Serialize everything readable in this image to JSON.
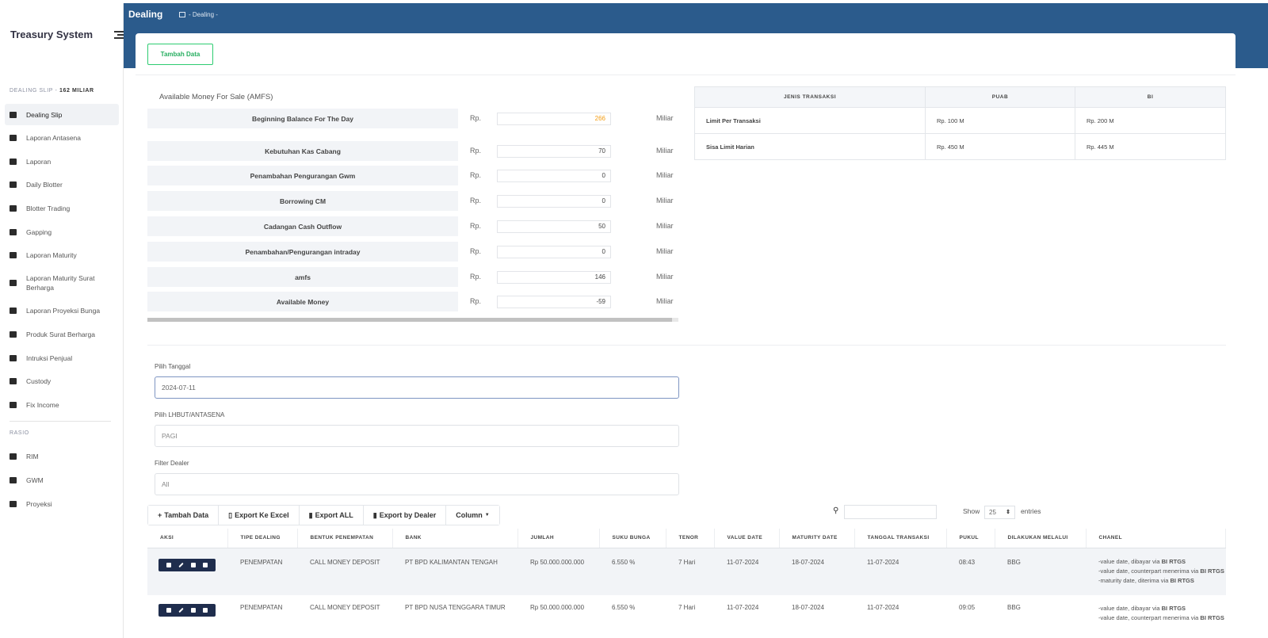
{
  "sidebar": {
    "brand": "Treasury System",
    "section1_title": "DEALING SLIP - ",
    "section1_bold": "162 MILIAR",
    "items": [
      {
        "label": "Dealing Slip",
        "icon": "calendar-icon"
      },
      {
        "label": "Laporan Antasena",
        "icon": "calendar-icon"
      },
      {
        "label": "Laporan",
        "icon": "list-icon"
      },
      {
        "label": "Daily Blotter",
        "icon": "folder-icon"
      },
      {
        "label": "Blotter Trading",
        "icon": "book-icon"
      },
      {
        "label": "Gapping",
        "icon": "building-icon"
      },
      {
        "label": "Laporan Maturity",
        "icon": "calendar-icon"
      },
      {
        "label": "Laporan Maturity Surat Berharga",
        "icon": "calendar-icon"
      },
      {
        "label": "Laporan Proyeksi Bunga",
        "icon": "calendar-icon"
      },
      {
        "label": "Produk Surat Berharga",
        "icon": "calendar-icon"
      },
      {
        "label": "Intruksi Penjual",
        "icon": "calendar-icon"
      },
      {
        "label": "Custody",
        "icon": "calendar-icon"
      },
      {
        "label": "Fix Income",
        "icon": "calendar-icon"
      }
    ],
    "section2_title": "RASIO",
    "items2": [
      {
        "label": "RIM",
        "icon": "calendar-icon"
      },
      {
        "label": "GWM",
        "icon": "calendar-icon"
      },
      {
        "label": "Proyeksi",
        "icon": "calendar-icon"
      }
    ]
  },
  "header": {
    "title": "Dealing",
    "breadcrumb": "- Dealing -"
  },
  "main": {
    "tambah_data_label": "Tambah Data",
    "amfs": {
      "title": "Available Money For Sale (AMFS)",
      "currency": "Rp.",
      "unit": "Miliar",
      "rows": [
        {
          "label": "Beginning Balance For The Day",
          "value": "266"
        },
        {
          "label": "Kebutuhan Kas Cabang",
          "value": "70"
        },
        {
          "label": "Penambahan Pengurangan Gwm",
          "value": "0"
        },
        {
          "label": "Borrowing CM",
          "value": "0"
        },
        {
          "label": "Cadangan Cash Outflow",
          "value": "50"
        },
        {
          "label": "Penambahan/Pengurangan intraday",
          "value": "0"
        },
        {
          "label": "amfs",
          "value": "146"
        },
        {
          "label": "Available Money",
          "value": "-59"
        }
      ]
    },
    "limit_table": {
      "headers": [
        "JENIS TRANSAKSI",
        "PUAB",
        "BI"
      ],
      "rows": [
        [
          "Limit Per Transaksi",
          "Rp. 100 M",
          "Rp. 200 M"
        ],
        [
          "Sisa Limit Harian",
          "Rp. 450 M",
          "Rp. 445 M"
        ]
      ]
    },
    "filters": {
      "tanggal_label": "Pilih Tanggal",
      "tanggal_value": "2024-07-11",
      "lhbut_label": "Pilih LHBUT/ANTASENA",
      "lhbut_value": "PAGI",
      "dealer_label": "Filter Dealer",
      "dealer_value": "All"
    },
    "toolbar": {
      "tambah": "Tambah Data",
      "export_excel": "Export Ke Excel",
      "export_all": "Export ALL",
      "export_dealer": "Export by Dealer",
      "column": "Column"
    },
    "show_label": "Show",
    "show_value": "25",
    "entries_label": "entries",
    "table": {
      "headers": [
        "AKSI",
        "TIPE DEALING",
        "BENTUK PENEMPATAN",
        "BANK",
        "JUMLAH",
        "SUKU BUNGA",
        "TENOR",
        "VALUE DATE",
        "MATURITY DATE",
        "TANGGAL TRANSAKSI",
        "PUKUL",
        "DILAKUKAN MELALUI",
        "CHANEL"
      ],
      "rows": [
        {
          "tipe": "PENEMPATAN",
          "bentuk": "CALL MONEY DEPOSIT",
          "bank": "PT BPD KALIMANTAN TENGAH",
          "jumlah": "Rp 50.000.000.000",
          "suku": "6.550 %",
          "tenor": "7 Hari",
          "value_date": "11-07-2024",
          "maturity": "18-07-2024",
          "tanggal": "11-07-2024",
          "pukul": "08:43",
          "melalui": "BBG",
          "chanel": [
            {
              "text": "-value date, dibayar via ",
              "bold": "BI RTGS"
            },
            {
              "text": "-value date, counterpart menerima via ",
              "bold": "BI RTGS"
            },
            {
              "text": "-maturity date, diterima via ",
              "bold": "BI RTGS"
            }
          ]
        },
        {
          "tipe": "PENEMPATAN",
          "bentuk": "CALL MONEY DEPOSIT",
          "bank": "PT BPD NUSA TENGGARA TIMUR",
          "jumlah": "Rp 50.000.000.000",
          "suku": "6.550 %",
          "tenor": "7 Hari",
          "value_date": "11-07-2024",
          "maturity": "18-07-2024",
          "tanggal": "11-07-2024",
          "pukul": "09:05",
          "melalui": "BBG",
          "chanel": [
            {
              "text": "-value date, dibayar via ",
              "bold": "BI RTGS"
            },
            {
              "text": "-value date, counterpart menerima via ",
              "bold": "BI RTGS"
            }
          ]
        }
      ]
    }
  }
}
